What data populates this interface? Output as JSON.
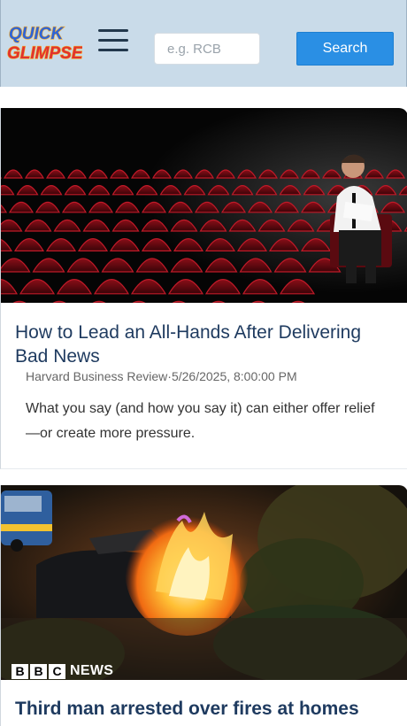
{
  "header": {
    "logo_text": [
      "QUICK",
      "GLIMPSE"
    ],
    "search": {
      "placeholder": "e.g. RCB",
      "value": ""
    },
    "search_button_label": "Search"
  },
  "articles": [
    {
      "title": "How to Lead an All-Hands After Delivering Bad News",
      "meta": "Harvard Business Review·5/26/2025, 8:00:00 PM",
      "description": "What you say (and how you say it) can either offer relief—or create more pressure.",
      "image_icon": "theater-seats-man-reading-image"
    },
    {
      "title": "Third man arrested over fires at homes",
      "image_icon": "car-fire-night-image",
      "image_brand": {
        "blocks": [
          "B",
          "B",
          "C"
        ],
        "word": "NEWS"
      }
    }
  ],
  "colors": {
    "header_bg": "#c9dbe9",
    "accent": "#2a8fe4",
    "title": "#1e3a5f",
    "logo_blue": "#2d64d8",
    "logo_red": "#e0322f",
    "logo_orange": "#f5a623"
  }
}
